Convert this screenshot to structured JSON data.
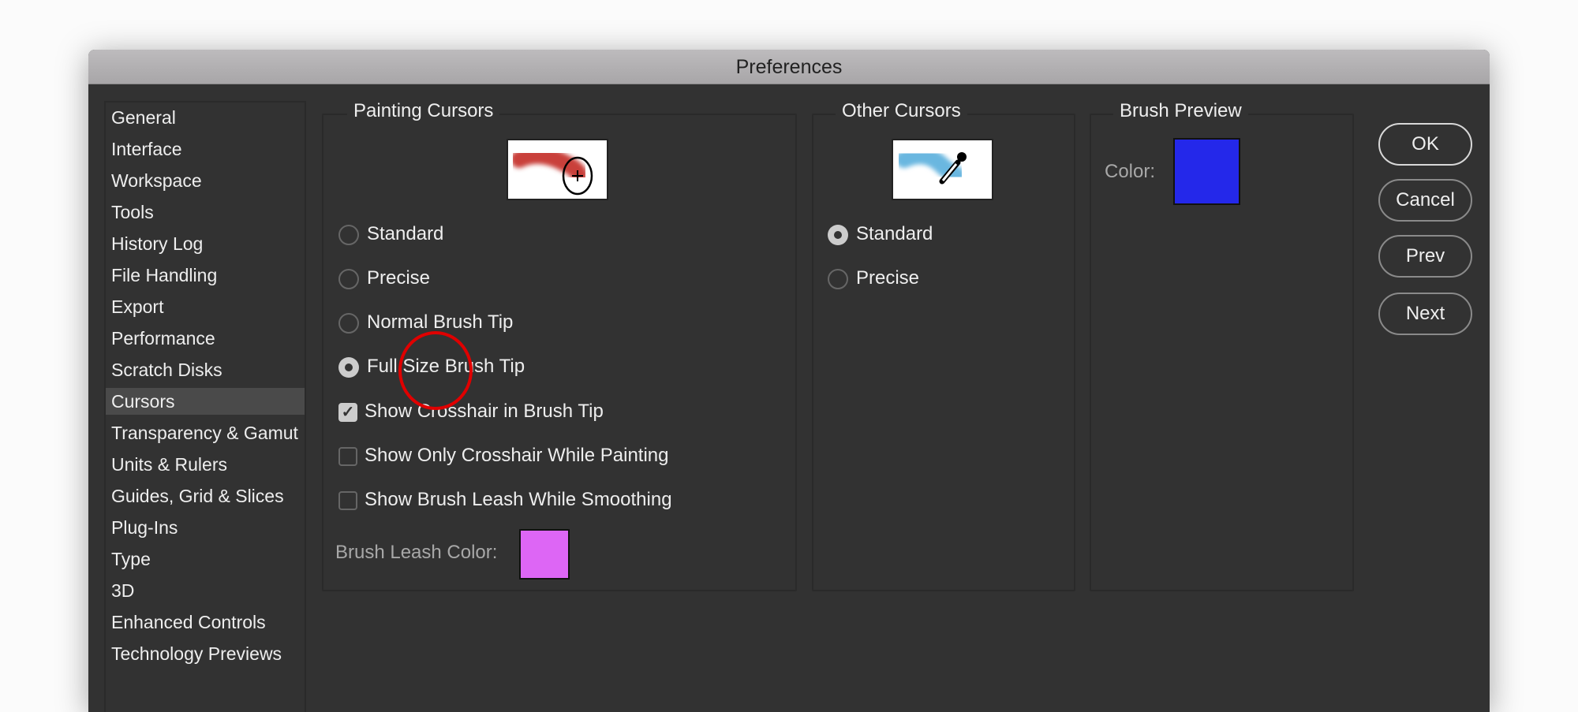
{
  "window": {
    "title": "Preferences"
  },
  "sidebar": {
    "selected": "Cursors",
    "items": [
      {
        "label": "General"
      },
      {
        "label": "Interface"
      },
      {
        "label": "Workspace"
      },
      {
        "label": "Tools"
      },
      {
        "label": "History Log"
      },
      {
        "label": "File Handling"
      },
      {
        "label": "Export"
      },
      {
        "label": "Performance"
      },
      {
        "label": "Scratch Disks"
      },
      {
        "label": "Cursors"
      },
      {
        "label": "Transparency & Gamut"
      },
      {
        "label": "Units & Rulers"
      },
      {
        "label": "Guides, Grid & Slices"
      },
      {
        "label": "Plug-Ins"
      },
      {
        "label": "Type"
      },
      {
        "label": "3D"
      },
      {
        "label": "Enhanced Controls"
      },
      {
        "label": "Technology Previews"
      }
    ]
  },
  "painting": {
    "title": "Painting Cursors",
    "options": [
      {
        "label": "Standard",
        "selected": false
      },
      {
        "label": "Precise",
        "selected": false
      },
      {
        "label": "Normal Brush Tip",
        "selected": false
      },
      {
        "label": "Full Size Brush Tip",
        "selected": true
      }
    ],
    "checks": [
      {
        "label": "Show Crosshair in Brush Tip",
        "checked": true
      },
      {
        "label": "Show Only Crosshair While Painting",
        "checked": false
      },
      {
        "label": "Show Brush Leash While Smoothing",
        "checked": false
      }
    ],
    "leash_label": "Brush Leash Color:",
    "leash_color": "#dd66f5"
  },
  "other": {
    "title": "Other Cursors",
    "options": [
      {
        "label": "Standard",
        "selected": true
      },
      {
        "label": "Precise",
        "selected": false
      }
    ]
  },
  "brush_preview": {
    "title": "Brush Preview",
    "color_label": "Color:",
    "color": "#2428ea"
  },
  "buttons": {
    "ok": "OK",
    "cancel": "Cancel",
    "prev": "Prev",
    "next": "Next"
  },
  "annotation": {
    "color": "#e00000"
  }
}
